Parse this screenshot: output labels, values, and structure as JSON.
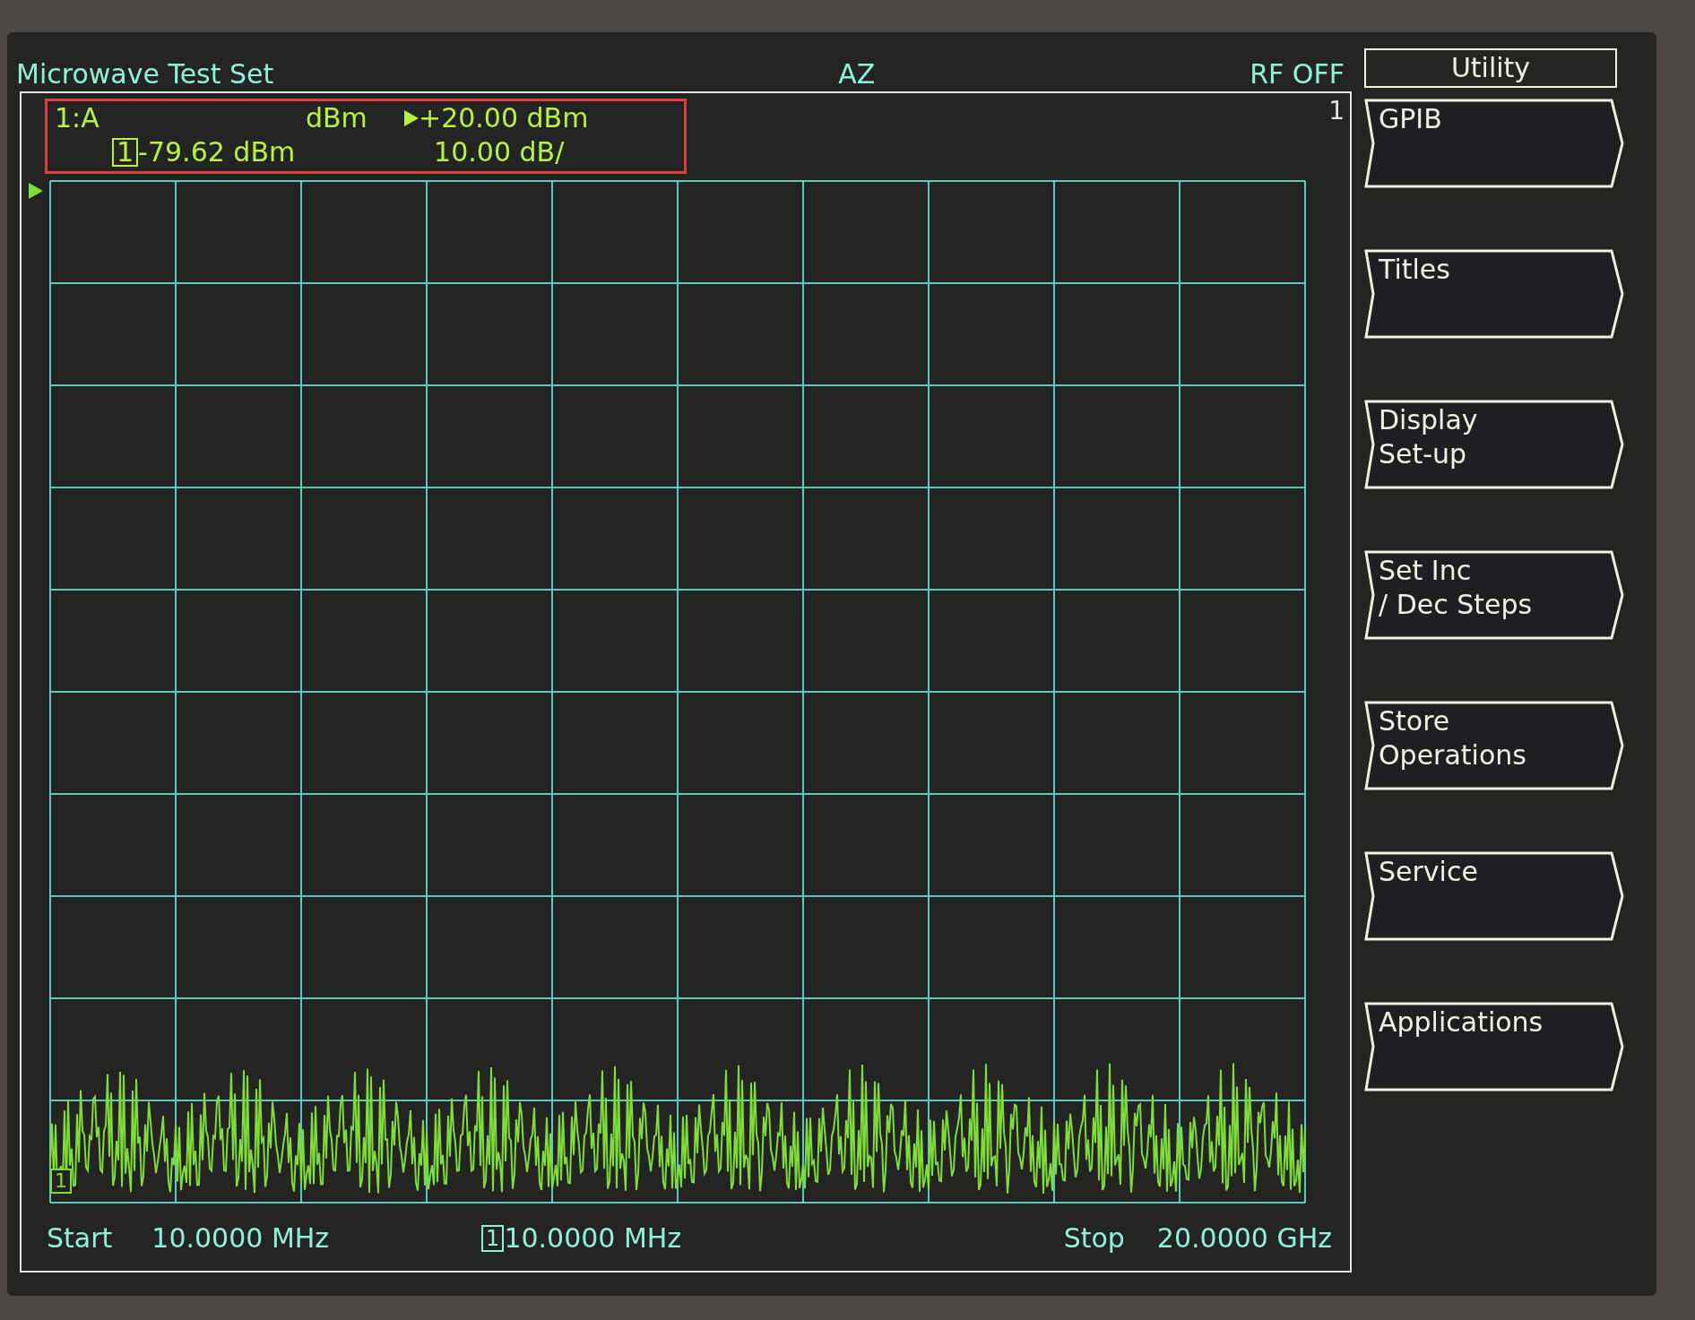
{
  "header": {
    "title": "Microwave Test Set",
    "mode": "AZ",
    "rf_status": "RF OFF"
  },
  "trace_info": {
    "channel": "1:A",
    "format": "dBm",
    "reference": "+20.00 dBm",
    "marker_number": "1",
    "marker_value": "-79.62 dBm",
    "scale": "10.00 dB/"
  },
  "plot": {
    "channel_number": "1",
    "trace_marker": "1"
  },
  "footer": {
    "start_label": "Start",
    "start_value": "10.0000 MHz",
    "marker_number": "1",
    "marker_value": "10.0000 MHz",
    "stop_label": "Stop",
    "stop_value": "20.0000 GHz"
  },
  "softkeys": {
    "menu_title": "Utility",
    "keys": [
      {
        "lines": [
          "GPIB"
        ]
      },
      {
        "lines": [
          "Titles"
        ]
      },
      {
        "lines": [
          "Display",
          "Set-up"
        ]
      },
      {
        "lines": [
          "Set Inc",
          "/ Dec Steps"
        ]
      },
      {
        "lines": [
          "Store",
          "Operations"
        ]
      },
      {
        "lines": [
          "Service"
        ]
      },
      {
        "lines": [
          "Applications"
        ]
      }
    ]
  }
}
